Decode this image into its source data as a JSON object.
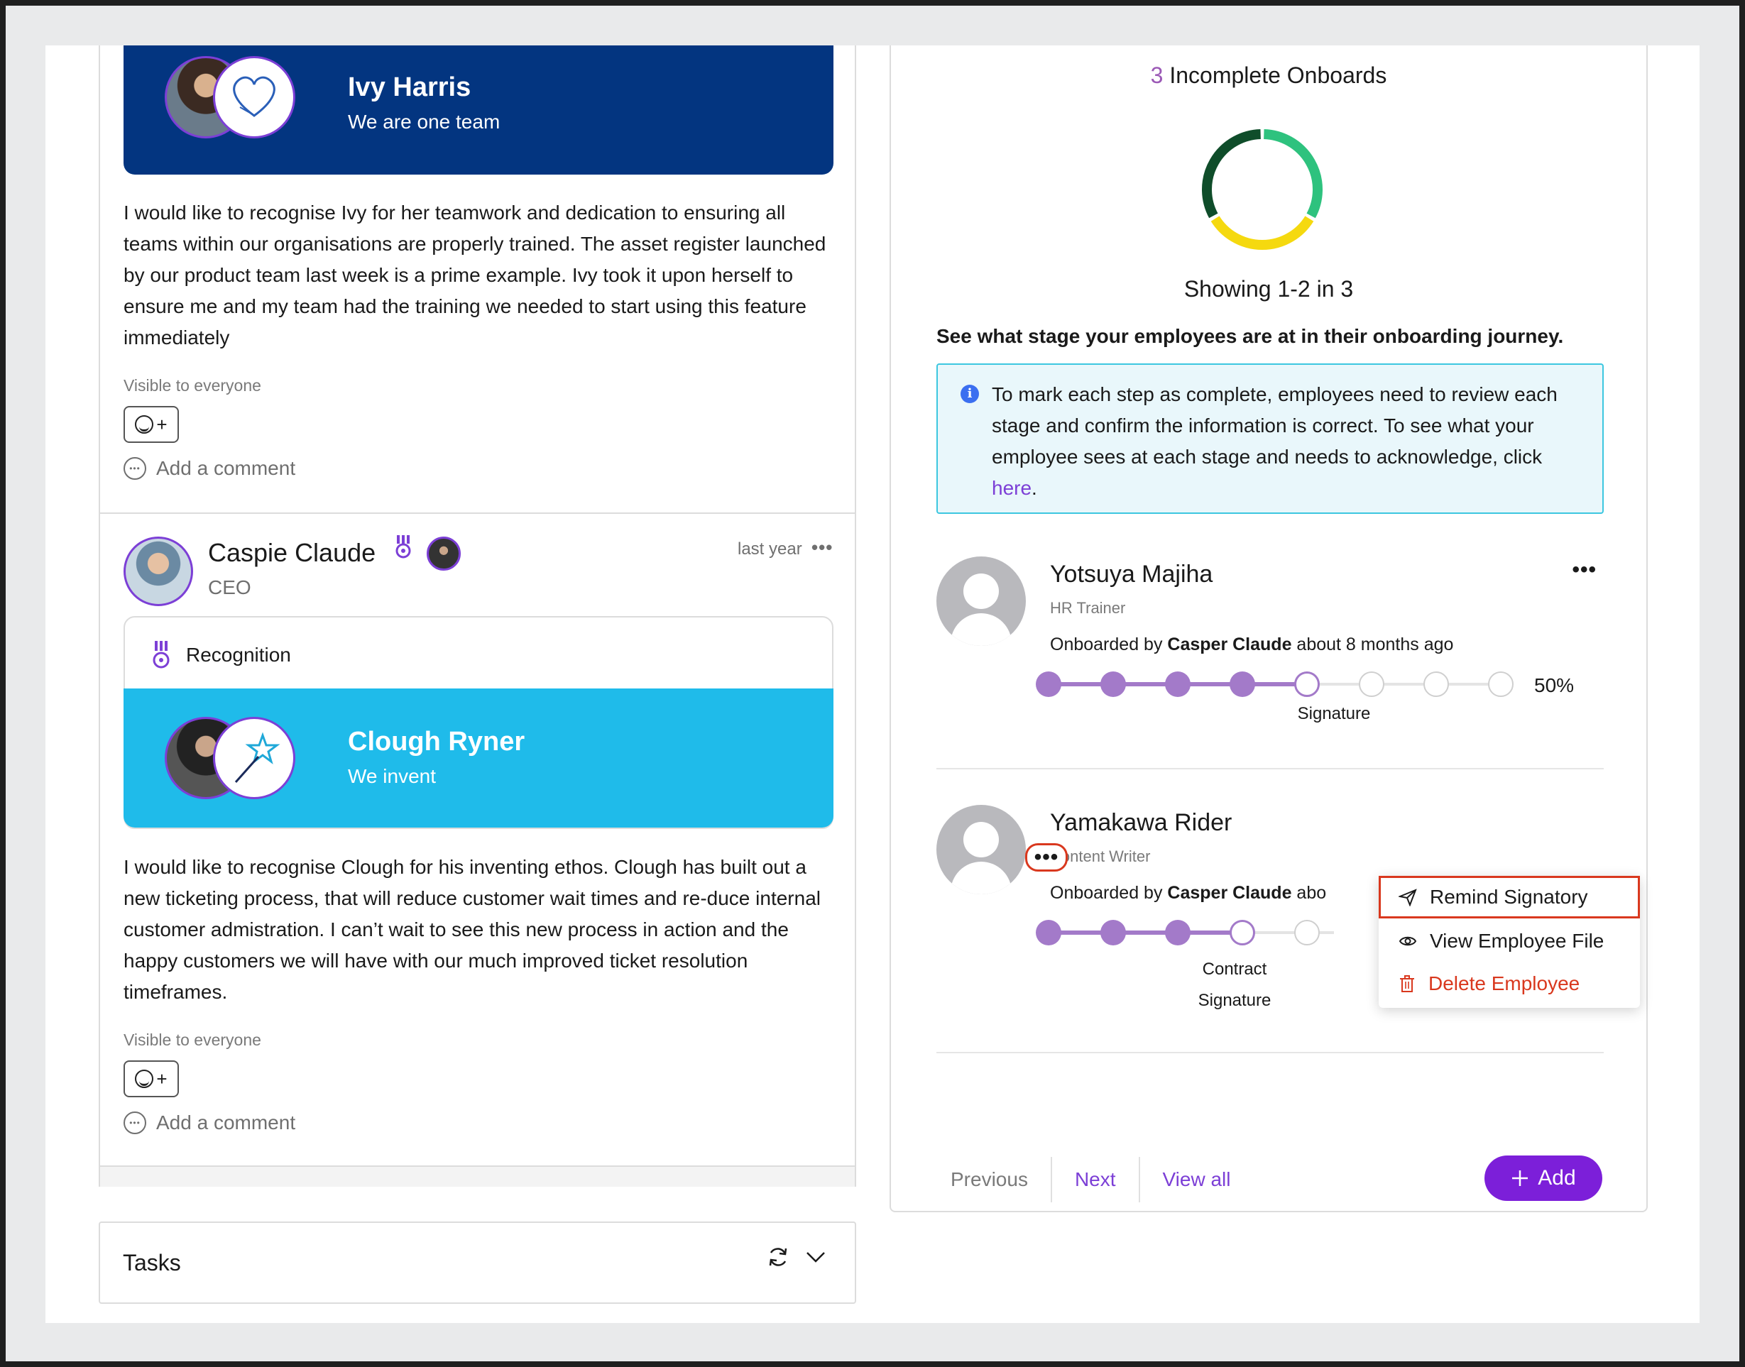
{
  "feed": {
    "post1": {
      "banner_name": "Ivy Harris",
      "banner_sub": "We are one team",
      "body": "I would like to recognise Ivy for her teamwork and dedication to ensuring all teams within our organisations are properly trained. The asset register launched by our product team last week is a prime example. Ivy took it upon herself to ensure me and my team had the training we needed to start using this feature immediately",
      "visibility": "Visible to everyone",
      "comment_placeholder": "Add a comment"
    },
    "post2": {
      "author": "Caspie Claude",
      "role": "CEO",
      "time": "last year",
      "card_type": "Recognition",
      "banner_name": "Clough Ryner",
      "banner_sub": "We invent",
      "body": "I would like to recognise Clough for his inventing ethos. Clough has built out a new ticketing process, that will reduce customer wait times and re-duce internal customer admistration. I can’t wait to see this new process in action and the happy customers we will have with our much improved ticket resolution timeframes.",
      "visibility": "Visible to everyone",
      "comment_placeholder": "Add a comment"
    }
  },
  "tasks": {
    "label": "Tasks"
  },
  "onboards": {
    "count": "3",
    "title": "Incomplete Onboards",
    "donut_colors": [
      "#2ec27e",
      "#f5d90f",
      "#0f4d2a"
    ],
    "showing": "Showing 1-2 in 3",
    "description": "See what stage your employees are at in their onboarding journey.",
    "info_text": "To mark each step as complete, employees need to review each stage and confirm the information is correct. To see what your employee sees at each stage and needs to acknowledge, click ",
    "info_link": "here",
    "info_end": ".",
    "employees": [
      {
        "name": "Yotsuya Majiha",
        "role": "HR Trainer",
        "onboarded_prefix": "Onboarded by ",
        "onboarded_by": "Casper Claude",
        "onboarded_suffix": " about 8 months ago",
        "progress": "50%",
        "stage": "Signature"
      },
      {
        "name": "Yamakawa Rider",
        "role": "Content Writer",
        "onboarded_prefix": "Onboarded by ",
        "onboarded_by": "Casper Claude",
        "onboarded_suffix": " abo",
        "stage_line1": "Contract",
        "stage_line2": "Signature"
      }
    ],
    "menu": [
      "Remind Signatory",
      "View Employee File",
      "Delete Employee"
    ],
    "pager": {
      "previous": "Previous",
      "next": "Next",
      "view_all": "View all"
    },
    "add_label": "Add"
  }
}
